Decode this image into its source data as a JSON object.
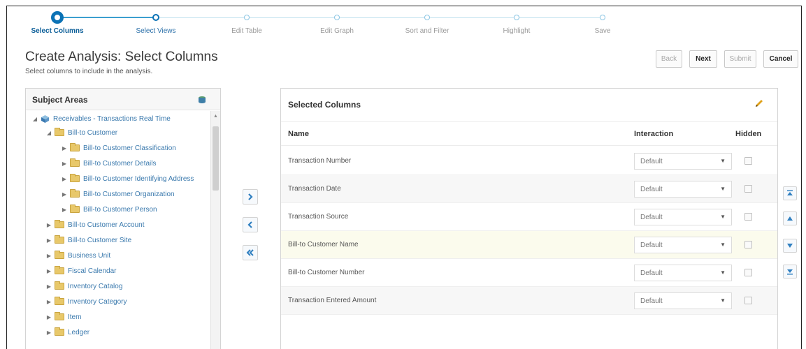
{
  "train": {
    "steps": [
      {
        "label": "Select Columns"
      },
      {
        "label": "Select Views"
      },
      {
        "label": "Edit Table"
      },
      {
        "label": "Edit Graph"
      },
      {
        "label": "Sort and Filter"
      },
      {
        "label": "Highlight"
      },
      {
        "label": "Save"
      }
    ]
  },
  "page": {
    "title": "Create Analysis: Select Columns",
    "subtitle": "Select columns to include in the analysis."
  },
  "buttons": {
    "back": "Back",
    "next": "Next",
    "submit": "Submit",
    "cancel": "Cancel"
  },
  "subject_areas": {
    "title": "Subject Areas",
    "items": [
      {
        "label": "Receivables - Transactions Real Time"
      },
      {
        "label": "Bill-to Customer"
      },
      {
        "label": "Bill-to Customer Classification"
      },
      {
        "label": "Bill-to Customer Details"
      },
      {
        "label": "Bill-to Customer Identifying Address"
      },
      {
        "label": "Bill-to Customer Organization"
      },
      {
        "label": "Bill-to Customer Person"
      },
      {
        "label": "Bill-to Customer Account"
      },
      {
        "label": "Bill-to Customer Site"
      },
      {
        "label": "Business Unit"
      },
      {
        "label": "Fiscal Calendar"
      },
      {
        "label": "Inventory Catalog"
      },
      {
        "label": "Inventory Category"
      },
      {
        "label": "Item"
      },
      {
        "label": "Ledger"
      }
    ]
  },
  "selected_columns": {
    "title": "Selected Columns",
    "headers": {
      "name": "Name",
      "interaction": "Interaction",
      "hidden": "Hidden"
    },
    "rows": [
      {
        "name": "Transaction Number",
        "interaction": "Default"
      },
      {
        "name": "Transaction Date",
        "interaction": "Default"
      },
      {
        "name": "Transaction Source",
        "interaction": "Default"
      },
      {
        "name": "Bill-to Customer Name",
        "interaction": "Default"
      },
      {
        "name": "Bill-to Customer Number",
        "interaction": "Default"
      },
      {
        "name": "Transaction Entered Amount",
        "interaction": "Default"
      }
    ]
  },
  "colors": {
    "accent": "#0b72b5",
    "link": "#3a79ad",
    "row_highlight": "#fbfbed"
  },
  "icons": [
    "database-icon",
    "cube-icon",
    "folder-icon",
    "pencil-icon",
    "move-right-icon",
    "move-left-icon",
    "move-all-left-icon",
    "move-top-icon",
    "move-up-icon",
    "move-down-icon",
    "move-bottom-icon"
  ]
}
